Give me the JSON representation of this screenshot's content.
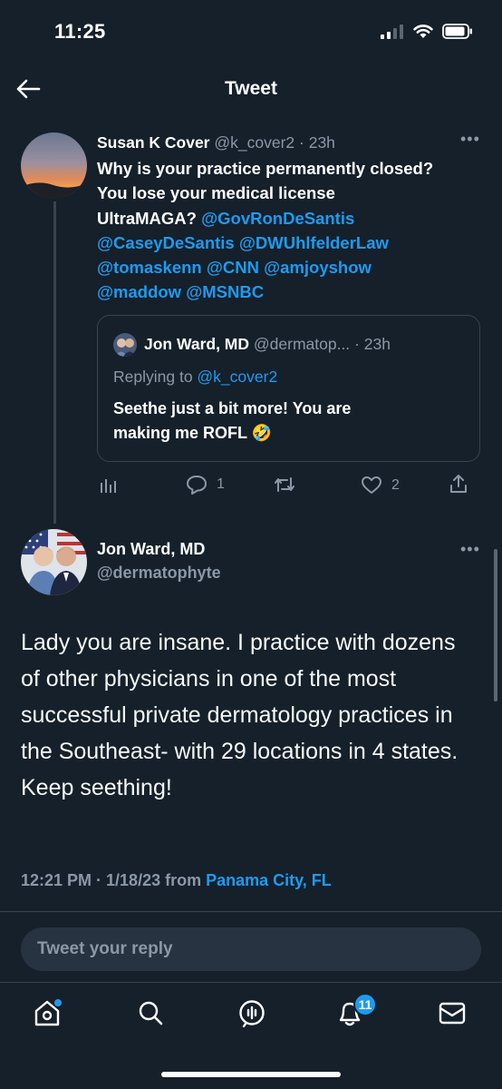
{
  "status_bar": {
    "time": "11:25"
  },
  "header": {
    "title": "Tweet"
  },
  "parent_tweet": {
    "display_name": "Susan K Cover",
    "handle": "@k_cover2",
    "separator": "·",
    "time": "23h",
    "text_lines": [
      [
        {
          "t": "Why is your practice permanently closed?",
          "link": false
        }
      ],
      [
        {
          "t": "You lose your medical license",
          "link": false
        }
      ],
      [
        {
          "t": "UltraMAGA? ",
          "link": false
        },
        {
          "t": "@GovRonDeSantis",
          "link": true
        }
      ],
      [
        {
          "t": "@CaseyDeSantis",
          "link": true
        },
        {
          "t": " ",
          "link": false
        },
        {
          "t": "@DWUhlfelderLaw",
          "link": true
        }
      ],
      [
        {
          "t": "@tomaskenn",
          "link": true
        },
        {
          "t": " ",
          "link": false
        },
        {
          "t": "@CNN",
          "link": true
        },
        {
          "t": " ",
          "link": false
        },
        {
          "t": "@amjoyshow",
          "link": true
        }
      ],
      [
        {
          "t": "@maddow",
          "link": true
        },
        {
          "t": " ",
          "link": false
        },
        {
          "t": "@MSNBC",
          "link": true
        }
      ]
    ],
    "quoted": {
      "display_name": "Jon Ward, MD",
      "handle": "@dermatop...",
      "time": "· 23h",
      "replying_prefix": "Replying to ",
      "replying_handle": "@k_cover2",
      "text_line1": "Seethe just a bit more! You are",
      "text_line2": "making me ROFL 🤣"
    },
    "actions": {
      "replies": "1",
      "likes": "2"
    }
  },
  "main_tweet": {
    "display_name": "Jon Ward, MD",
    "handle": "@dermatophyte",
    "text": "Lady you are insane.  I practice with dozens of other physicians in one of the most successful private dermatology practices in the Southeast- with 29 locations in 4 states.  Keep seething!",
    "timestamp": "12:21 PM · 1/18/23 from ",
    "location": "Panama City, FL"
  },
  "reply": {
    "placeholder": "Tweet your reply"
  },
  "bottom_nav": {
    "items": [
      "home-icon",
      "search-icon",
      "spaces-icon",
      "notifications-icon",
      "messages-icon"
    ],
    "notification_count": "11"
  },
  "colors": {
    "background": "#15202b",
    "accent": "#1d9bf0",
    "secondary_text": "#8b98a5",
    "border": "#38444d"
  }
}
